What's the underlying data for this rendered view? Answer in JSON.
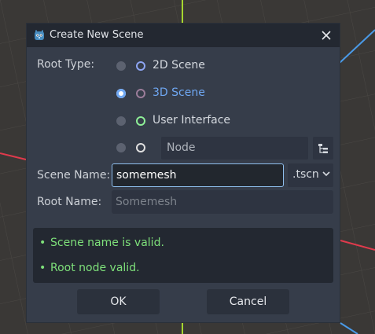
{
  "dialog": {
    "title": "Create New Scene",
    "close_symbol": "✕"
  },
  "root_type": {
    "label": "Root Type:",
    "selected": "3D Scene",
    "options": [
      {
        "label": "2D Scene",
        "icon": "node2d-icon",
        "color": "#8da5f3",
        "selected": false
      },
      {
        "label": "3D Scene",
        "icon": "node3d-icon",
        "color": "#fc7f7f",
        "selected": true
      },
      {
        "label": "User Interface",
        "icon": "control-icon",
        "color": "#8eef97",
        "selected": false
      },
      {
        "label": "",
        "icon": "node-icon",
        "color": "#e0e0e0",
        "selected": false
      }
    ],
    "other_node_value": "Node"
  },
  "scene_name": {
    "label": "Scene Name:",
    "value": "somemesh",
    "extension": ".tscn"
  },
  "root_name": {
    "label": "Root Name:",
    "placeholder": "Somemesh"
  },
  "status": {
    "bullet": "•",
    "messages": [
      "Scene name is valid.",
      "Root node valid."
    ],
    "color": "#7ee07a"
  },
  "buttons": {
    "ok": "OK",
    "cancel": "Cancel"
  },
  "theme": {
    "accent": "#6fa7f2",
    "selected_text": "#6fa7f2"
  }
}
